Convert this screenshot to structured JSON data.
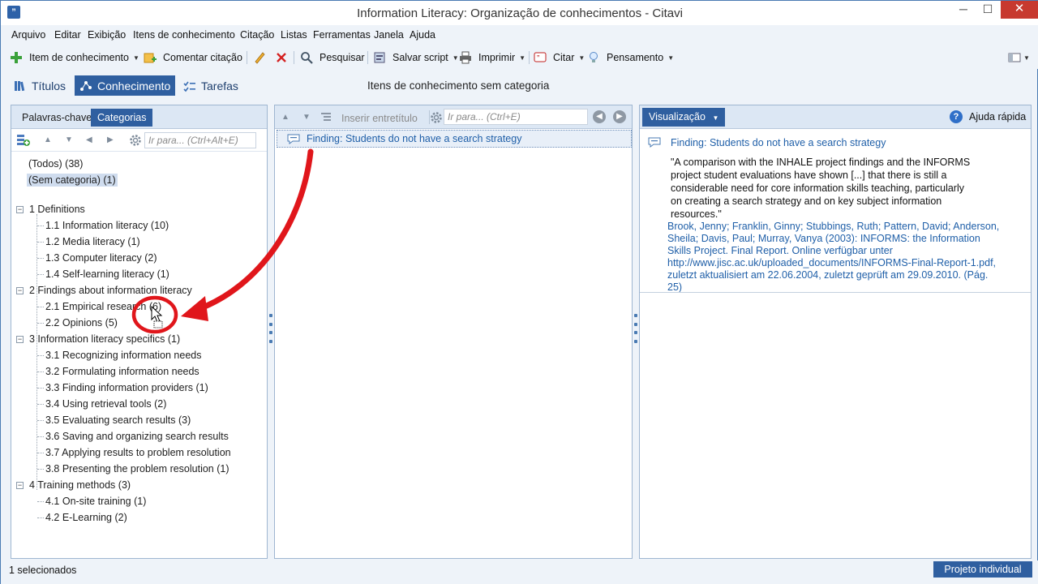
{
  "window": {
    "title": "Information Literacy: Organização de conhecimentos - Citavi",
    "minimize": "─",
    "maximize": "☐",
    "close": "✕"
  },
  "menu": [
    "Arquivo",
    "Editar",
    "Exibição",
    "Itens de conhecimento",
    "Citação",
    "Listas",
    "Ferramentas",
    "Janela",
    "Ajuda"
  ],
  "toolbar": {
    "knowledge_item": "Item de conhecimento",
    "comment_citation": "Comentar citação",
    "search": "Pesquisar",
    "save_script": "Salvar script",
    "print": "Imprimir",
    "cite": "Citar",
    "thought": "Pensamento"
  },
  "modes": {
    "titles": "Títulos",
    "knowledge": "Conhecimento",
    "tasks": "Tarefas"
  },
  "view_title": "Itens de conhecimento sem categoria",
  "left_panel": {
    "tab_keywords": "Palavras-chave",
    "tab_categories": "Categorias",
    "search_placeholder": "Ir para... (Ctrl+Alt+E)",
    "all": "(Todos) (38)",
    "uncategorized": "(Sem categoria) (1)",
    "tree": [
      {
        "label": "1 Definitions",
        "children": [
          "1.1 Information literacy (10)",
          "1.2 Media literacy (1)",
          "1.3 Computer literacy (2)",
          "1.4 Self-learning literacy (1)"
        ]
      },
      {
        "label": "2 Findings about information literacy",
        "children": [
          "2.1 Empirical research (6)",
          "2.2 Opinions (5)"
        ]
      },
      {
        "label": "3 Information literacy specifics (1)",
        "children": [
          "3.1 Recognizing information needs",
          "3.2 Formulating information needs",
          "3.3 Finding information providers (1)",
          "3.4 Using retrieval tools (2)",
          "3.5 Evaluating search results (3)",
          "3.6 Saving and organizing search results",
          "3.7 Applying results to problem resolution",
          "3.8 Presenting the problem resolution (1)"
        ]
      },
      {
        "label": "4 Training methods (3)",
        "children": [
          "4.1 On-site training (1)",
          "4.2 E-Learning (2)"
        ]
      }
    ]
  },
  "middle_panel": {
    "insert_subheading": "Inserir entretítulo",
    "search_placeholder": "Ir para... (Ctrl+E)",
    "item": "Finding: Students do not have a search strategy"
  },
  "right_panel": {
    "preview_button": "Visualização",
    "quick_help": "Ajuda rápida",
    "title": "Finding: Students do not have a search strategy",
    "quote": "\"A comparison with the INHALE project findings and the INFORMS project student evaluations have shown [...] that there is still a considerable need for core information skills teaching, particularly on creating a search strategy and on key subject information resources.\"",
    "reference": "Brook, Jenny; Franklin, Ginny; Stubbings, Ruth; Pattern, David; Anderson, Sheila; Davis, Paul; Murray, Vanya (2003): INFORMS: the Information Skills Project. Final Report. Online verfügbar unter http://www.jisc.ac.uk/uploaded_documents/INFORMS-Final-Report-1.pdf, zuletzt aktualisiert am 22.06.2004, zuletzt geprüft am 29.09.2010. (Pág. 25)"
  },
  "status": {
    "selected": "1 selecionados",
    "project_type": "Projeto individual"
  },
  "colors": {
    "accent": "#2f5fa0",
    "link": "#1f5fa8",
    "annotation": "#e0161b"
  }
}
